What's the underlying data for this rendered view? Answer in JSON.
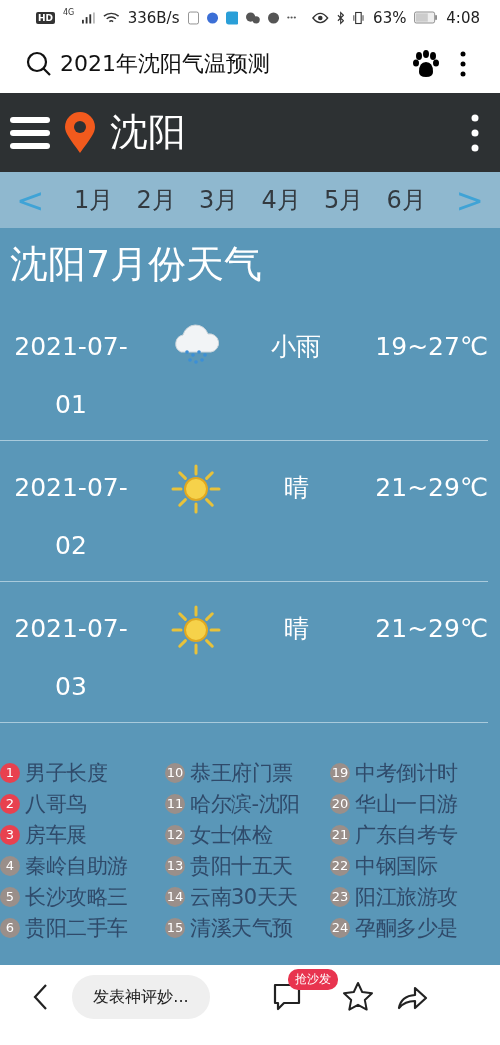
{
  "status_bar": {
    "hd": "HD",
    "network": "4G",
    "speed": "336B/s",
    "battery": "63%",
    "time": "4:08"
  },
  "search": {
    "query": "2021年沈阳气温预测"
  },
  "header": {
    "city": "沈阳"
  },
  "months": {
    "prev": "<",
    "next": ">",
    "items": [
      "1月",
      "2月",
      "3月",
      "4月",
      "5月",
      "6月"
    ]
  },
  "title": "沈阳7月份天气",
  "days": [
    {
      "date": "2021-07-01",
      "kind": "rain",
      "condition": "小雨",
      "temp": "19~27℃"
    },
    {
      "date": "2021-07-02",
      "kind": "sunny",
      "condition": "晴",
      "temp": "21~29℃"
    },
    {
      "date": "2021-07-03",
      "kind": "sunny",
      "condition": "晴",
      "temp": "21~29℃"
    }
  ],
  "hot_list": [
    {
      "rank": "1",
      "text": "男子长度",
      "top": true
    },
    {
      "rank": "2",
      "text": "八哥鸟",
      "top": true
    },
    {
      "rank": "3",
      "text": "房车展",
      "top": true
    },
    {
      "rank": "4",
      "text": "秦岭自助游",
      "top": false
    },
    {
      "rank": "5",
      "text": "长沙攻略三",
      "top": false
    },
    {
      "rank": "6",
      "text": "贵阳二手车",
      "top": false
    },
    {
      "rank": "10",
      "text": "恭王府门票",
      "top": false
    },
    {
      "rank": "11",
      "text": "哈尔滨-沈阳",
      "top": false
    },
    {
      "rank": "12",
      "text": "女士体检",
      "top": false
    },
    {
      "rank": "13",
      "text": "贵阳十五天",
      "top": false
    },
    {
      "rank": "14",
      "text": "云南30天天",
      "top": false
    },
    {
      "rank": "15",
      "text": "清溪天气预",
      "top": false
    },
    {
      "rank": "19",
      "text": "中考倒计时",
      "top": false
    },
    {
      "rank": "20",
      "text": "华山一日游",
      "top": false
    },
    {
      "rank": "21",
      "text": "广东自考专",
      "top": false
    },
    {
      "rank": "22",
      "text": "中钢国际",
      "top": false
    },
    {
      "rank": "23",
      "text": "阳江旅游攻",
      "top": false
    },
    {
      "rank": "24",
      "text": "孕酮多少是",
      "top": false
    }
  ],
  "bottom_bar": {
    "comment_placeholder": "发表神评妙...",
    "comment_badge": "抢沙发"
  }
}
